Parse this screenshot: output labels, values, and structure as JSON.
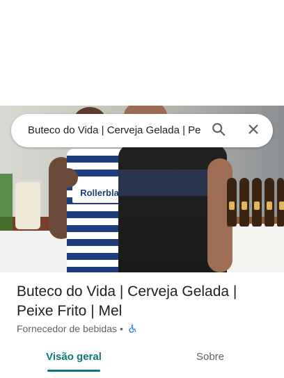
{
  "search": {
    "query": "Buteco do Vida | Cerveja Gelada | Pe"
  },
  "place": {
    "title": "Buteco do Vida | Cerveja Gelada | Peixe Frito | Mel",
    "category": "Fornecedor de bebidas",
    "separator": "•",
    "accessibility_icon": "wheelchair-icon"
  },
  "photo": {
    "shirt_print": "Rollerbla"
  },
  "tabs": [
    {
      "label": "Visão geral",
      "selected": true
    },
    {
      "label": "Sobre",
      "selected": false
    }
  ],
  "colors": {
    "accent": "#0b7a78",
    "text_primary": "#1f1f1f",
    "text_secondary": "#5f6368",
    "a11y_icon": "#1a73e8"
  }
}
